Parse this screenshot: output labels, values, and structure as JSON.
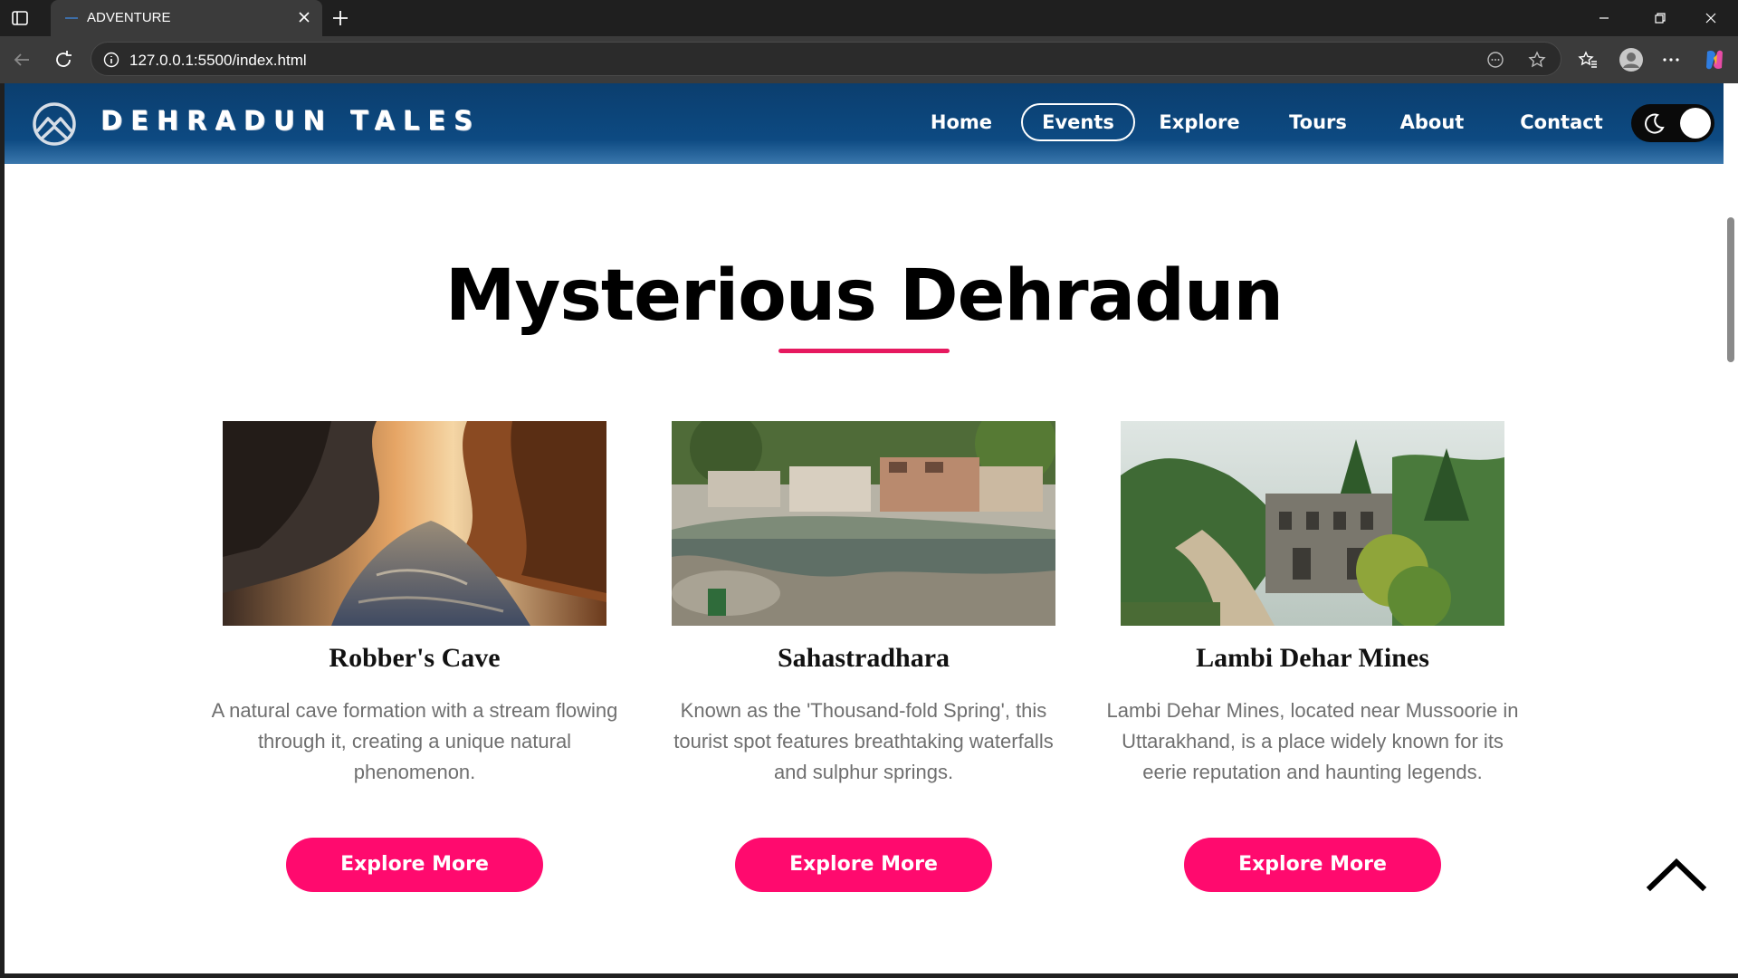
{
  "browser": {
    "tab_title": "ADVENTURE",
    "url": "127.0.0.1:5500/index.html"
  },
  "site": {
    "brand": "DEHRADUN TALES",
    "nav": [
      {
        "label": "Home",
        "active": false
      },
      {
        "label": "Events",
        "active": true
      },
      {
        "label": "Explore",
        "active": false
      },
      {
        "label": "Tours",
        "active": false
      },
      {
        "label": "About",
        "active": false
      },
      {
        "label": "Contact",
        "active": false
      }
    ],
    "theme_toggle_icon": "moon-icon"
  },
  "main": {
    "title": "Mysterious Dehradun",
    "accent_color": "#ff0a6e",
    "cards": [
      {
        "title": "Robber's Cave",
        "description": "A natural cave formation with a stream flowing through it, creating a unique natural phenomenon.",
        "button": "Explore More"
      },
      {
        "title": "Sahastradhara",
        "description": "Known as the 'Thousand-fold Spring', this tourist spot features breathtaking waterfalls and sulphur springs.",
        "button": "Explore More"
      },
      {
        "title": "Lambi Dehar Mines",
        "description": "Lambi Dehar Mines, located near Mussoorie in Uttarakhand, is a place widely known for its eerie reputation and haunting legends.",
        "button": "Explore More"
      }
    ]
  }
}
